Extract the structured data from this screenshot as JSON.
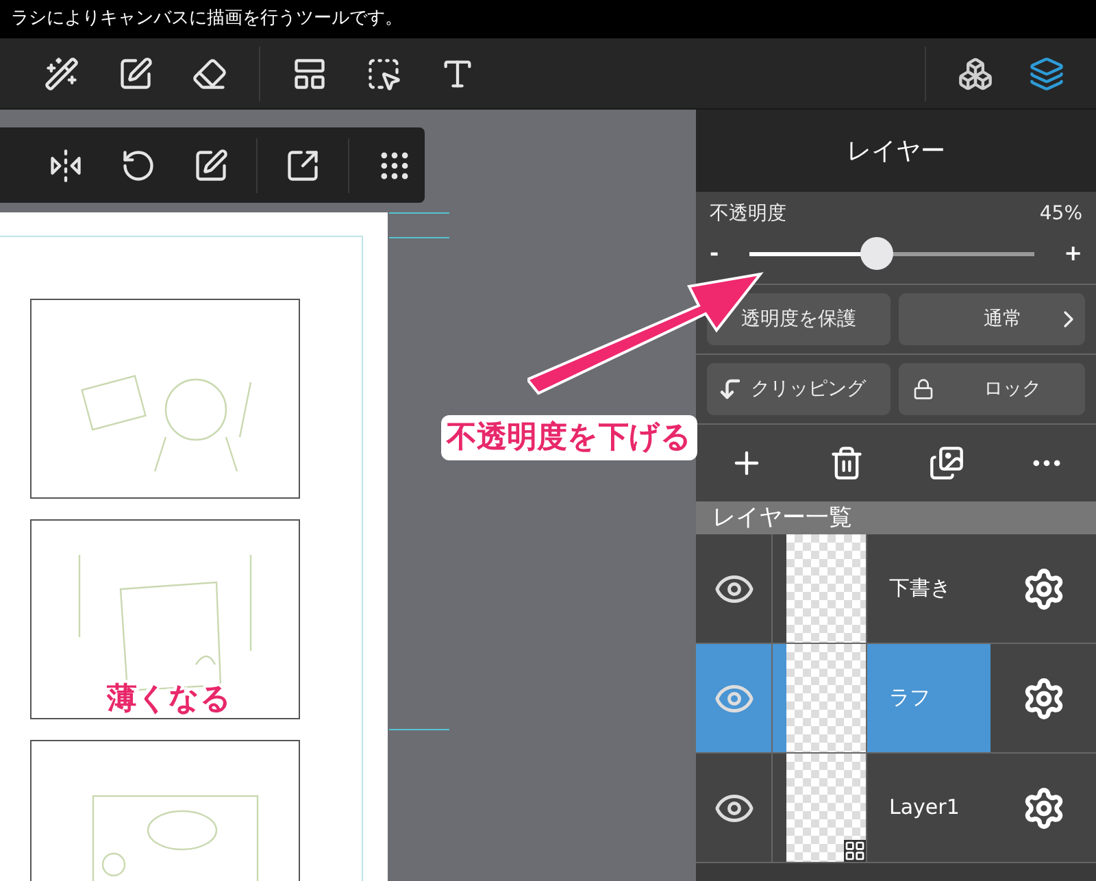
{
  "tooltip": "ラシによりキャンバスに描画を行うツールです。",
  "panel_tabs": [
    {
      "selected": false
    },
    {
      "selected": true
    }
  ],
  "layer_panel": {
    "title": "レイヤー",
    "opacity": {
      "label": "不透明度",
      "reading": "45%",
      "level": 0.45,
      "minus": "-",
      "plus": "+"
    },
    "protect_button": "透明度を保護",
    "blend_mode": "通常",
    "clipping_button": "クリッピング",
    "lock_button": "ロック",
    "list_title": "レイヤー一覧",
    "layers": [
      {
        "name": "下書き",
        "selected": false,
        "visible": true,
        "frame_badge": false
      },
      {
        "name": "ラフ",
        "selected": true,
        "visible": true,
        "frame_badge": false
      },
      {
        "name": "Layer1",
        "selected": false,
        "visible": true,
        "frame_badge": true
      }
    ]
  },
  "annotations": [
    "不透明度を下げる",
    "薄くなる"
  ]
}
